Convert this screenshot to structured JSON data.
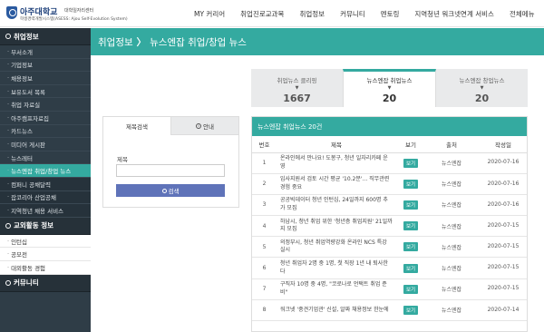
{
  "header": {
    "logo_name": "아주대학교",
    "logo_sub1": "대학일자리센터",
    "logo_sub2": "학생경력개발시스템(ASESS: Ajou Self-Evolution System)",
    "nav": [
      "MY 커리어",
      "취업진로교과목",
      "취업정보",
      "커뮤니티",
      "멘토링",
      "지역청년 워크넷연계 서비스",
      "전체메뉴"
    ]
  },
  "sidebar": {
    "sections": [
      {
        "title": "취업정보",
        "items": [
          {
            "label": "부서소개",
            "state": "normal"
          },
          {
            "label": "기업정보",
            "state": "normal"
          },
          {
            "label": "채용정보",
            "state": "normal"
          },
          {
            "label": "보유도서 목록",
            "state": "normal"
          },
          {
            "label": "취업 자료실",
            "state": "normal"
          },
          {
            "label": "아주캠프자료집",
            "state": "normal"
          },
          {
            "label": "카드뉴스",
            "state": "normal"
          },
          {
            "label": "미디어 게시판",
            "state": "normal"
          },
          {
            "label": "뉴스레터",
            "state": "normal"
          },
          {
            "label": "뉴스엔잡 취업/창업 뉴스",
            "state": "active"
          },
          {
            "label": "컴퍼니 공채달력",
            "state": "dark"
          },
          {
            "label": "잡코리아 산업공채",
            "state": "dark"
          },
          {
            "label": "지역청년 채용 서비스",
            "state": "dark"
          }
        ]
      },
      {
        "title": "교외활동 정보",
        "items": [
          {
            "label": "인턴십",
            "state": "white"
          },
          {
            "label": "공모전",
            "state": "white"
          },
          {
            "label": "대외활동 경험",
            "state": "white"
          }
        ]
      },
      {
        "title": "커뮤니티",
        "items": []
      }
    ]
  },
  "titlebar": {
    "part1": "취업정보",
    "sep": "〉",
    "part2": "뉴스엔잡 취업/창업 뉴스"
  },
  "count_tabs": [
    {
      "label": "취업뉴스 클리핑",
      "arrow": "▼",
      "count": "1667",
      "active": false
    },
    {
      "label": "뉴스엔잡 취업뉴스",
      "arrow": "▼",
      "count": "20",
      "active": true
    },
    {
      "label": "뉴스엔잡 창업뉴스",
      "arrow": "▼",
      "count": "20",
      "active": false
    }
  ],
  "search_panel": {
    "tab_search": "제목검색",
    "tab_guide": "안내",
    "field_label": "제목",
    "input_value": "",
    "button_label": "검색"
  },
  "news": {
    "heading": "뉴스엔잡 취업뉴스 20건",
    "columns": [
      "번호",
      "제목",
      "보기",
      "출처",
      "작성일"
    ],
    "view_label": "보기",
    "rows": [
      {
        "no": "1",
        "title": "온라인에서 만나요! 도봉구, 청년 일자리카페 운영",
        "source": "뉴스엔잡",
        "date": "2020-07-16"
      },
      {
        "no": "2",
        "title": "입사지원서 검토 시간 평균 '10.2분'... 직무관련 경험 중요",
        "source": "뉴스엔잡",
        "date": "2020-07-16"
      },
      {
        "no": "3",
        "title": "공공빅데이터 청년 인턴십, 24일까지 600명 추가 모집",
        "source": "뉴스엔잡",
        "date": "2020-07-16"
      },
      {
        "no": "4",
        "title": "하남시, 청년 취업 위한 '청년층 취업지원' 21일까지 모집",
        "source": "뉴스엔잡",
        "date": "2020-07-15"
      },
      {
        "no": "5",
        "title": "의정부시, 청년 취업역량강화 온라인 NCS 특강 실시",
        "source": "뉴스엔잡",
        "date": "2020-07-15"
      },
      {
        "no": "6",
        "title": "청년 취업자 2명 중 1명, 첫 직장 1년 내 퇴사한다",
        "source": "뉴스엔잡",
        "date": "2020-07-15"
      },
      {
        "no": "7",
        "title": "구직자 10명 중 4명, \"코로나로 언택트 취업 준비\"",
        "source": "뉴스엔잡",
        "date": "2020-07-15"
      },
      {
        "no": "8",
        "title": "워크넷 '중견기업관' 신설, 알짜 채용정보 한눈에",
        "source": "뉴스엔잡",
        "date": "2020-07-14"
      }
    ]
  }
}
